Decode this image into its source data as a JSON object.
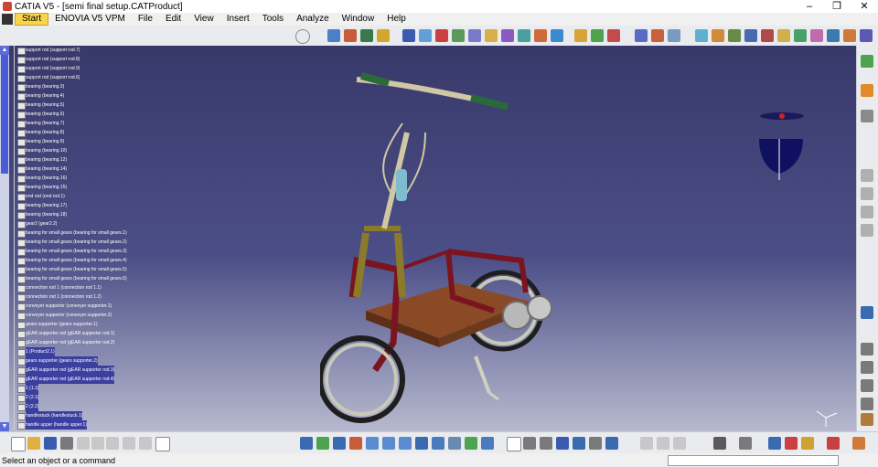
{
  "window": {
    "title": "CATIA V5 - [semi final setup.CATProduct]",
    "minimize": "–",
    "restore": "❐",
    "close": "✕"
  },
  "menubar": {
    "items": [
      {
        "label": "Start"
      },
      {
        "label": "ENOVIA V5 VPM"
      },
      {
        "label": "File"
      },
      {
        "label": "Edit"
      },
      {
        "label": "View"
      },
      {
        "label": "Insert"
      },
      {
        "label": "Tools"
      },
      {
        "label": "Analyze"
      },
      {
        "label": "Window"
      },
      {
        "label": "Help"
      }
    ],
    "mdi": [
      "–",
      "❐",
      "✕"
    ]
  },
  "tree": {
    "items": [
      "support rod (support rod.7)",
      "support rod (support rod.8)",
      "support rod (support rod.9)",
      "support rod (support rod.6)",
      "bearing (bearing.3)",
      "bearing (bearing.4)",
      "bearing (bearing.5)",
      "bearing (bearing.6)",
      "bearing (bearing.7)",
      "bearing (bearing.8)",
      "bearing (bearing.9)",
      "bearing (bearing.10)",
      "bearing (bearing.12)",
      "bearing (bearing.14)",
      "bearing (bearing.16)",
      "bearing (bearing.15)",
      "end rod (end rod.1)",
      "bearing (bearing.17)",
      "bearing (bearing.18)",
      "gear2 (gear2.2)",
      "bearing for small gears (bearing for small gears.1)",
      "bearing for small gears (bearing for small gears.2)",
      "bearing for small gears (bearing for small gears.3)",
      "bearing for small gears (bearing for small gears.4)",
      "bearing for small gears (bearing for small gears.5)",
      "bearing for small gears (bearing for small gears.6)",
      "connection rod 1 (connection rod 1.1)",
      "connection rod 1 (connection rod 1.2)",
      "conveyer supporter (conveyer supporter.1)",
      "conveyer supporter (conveyer supporter.2)",
      "gears supporter (gears supporter.1)",
      "gEAR supporter rod (gEAR supporter rod.1)",
      "gEAR supporter rod (gEAR supporter rod.2)",
      "1 (Product2.1)",
      "gears supporter (gears supporter.2)",
      "gEAR supporter rod (gEAR supporter rod.3)",
      "gEAR supporter rod (gEAR supporter rod.4)",
      "1 (1.1)",
      "2 (2.1)",
      "2 (2.2)",
      "handlestuck (handlestuck.1)",
      "handle upper (handle upper.1)"
    ],
    "highlighted": [
      33,
      34,
      35,
      36,
      37,
      38,
      39,
      40,
      41
    ]
  },
  "status": {
    "message": "Select an object or a command"
  },
  "colors": {
    "frame": "#7a1420",
    "conveyor": "#8a4a26",
    "fork": "#8a7a2a",
    "handlebar": "#2a6a3a"
  }
}
